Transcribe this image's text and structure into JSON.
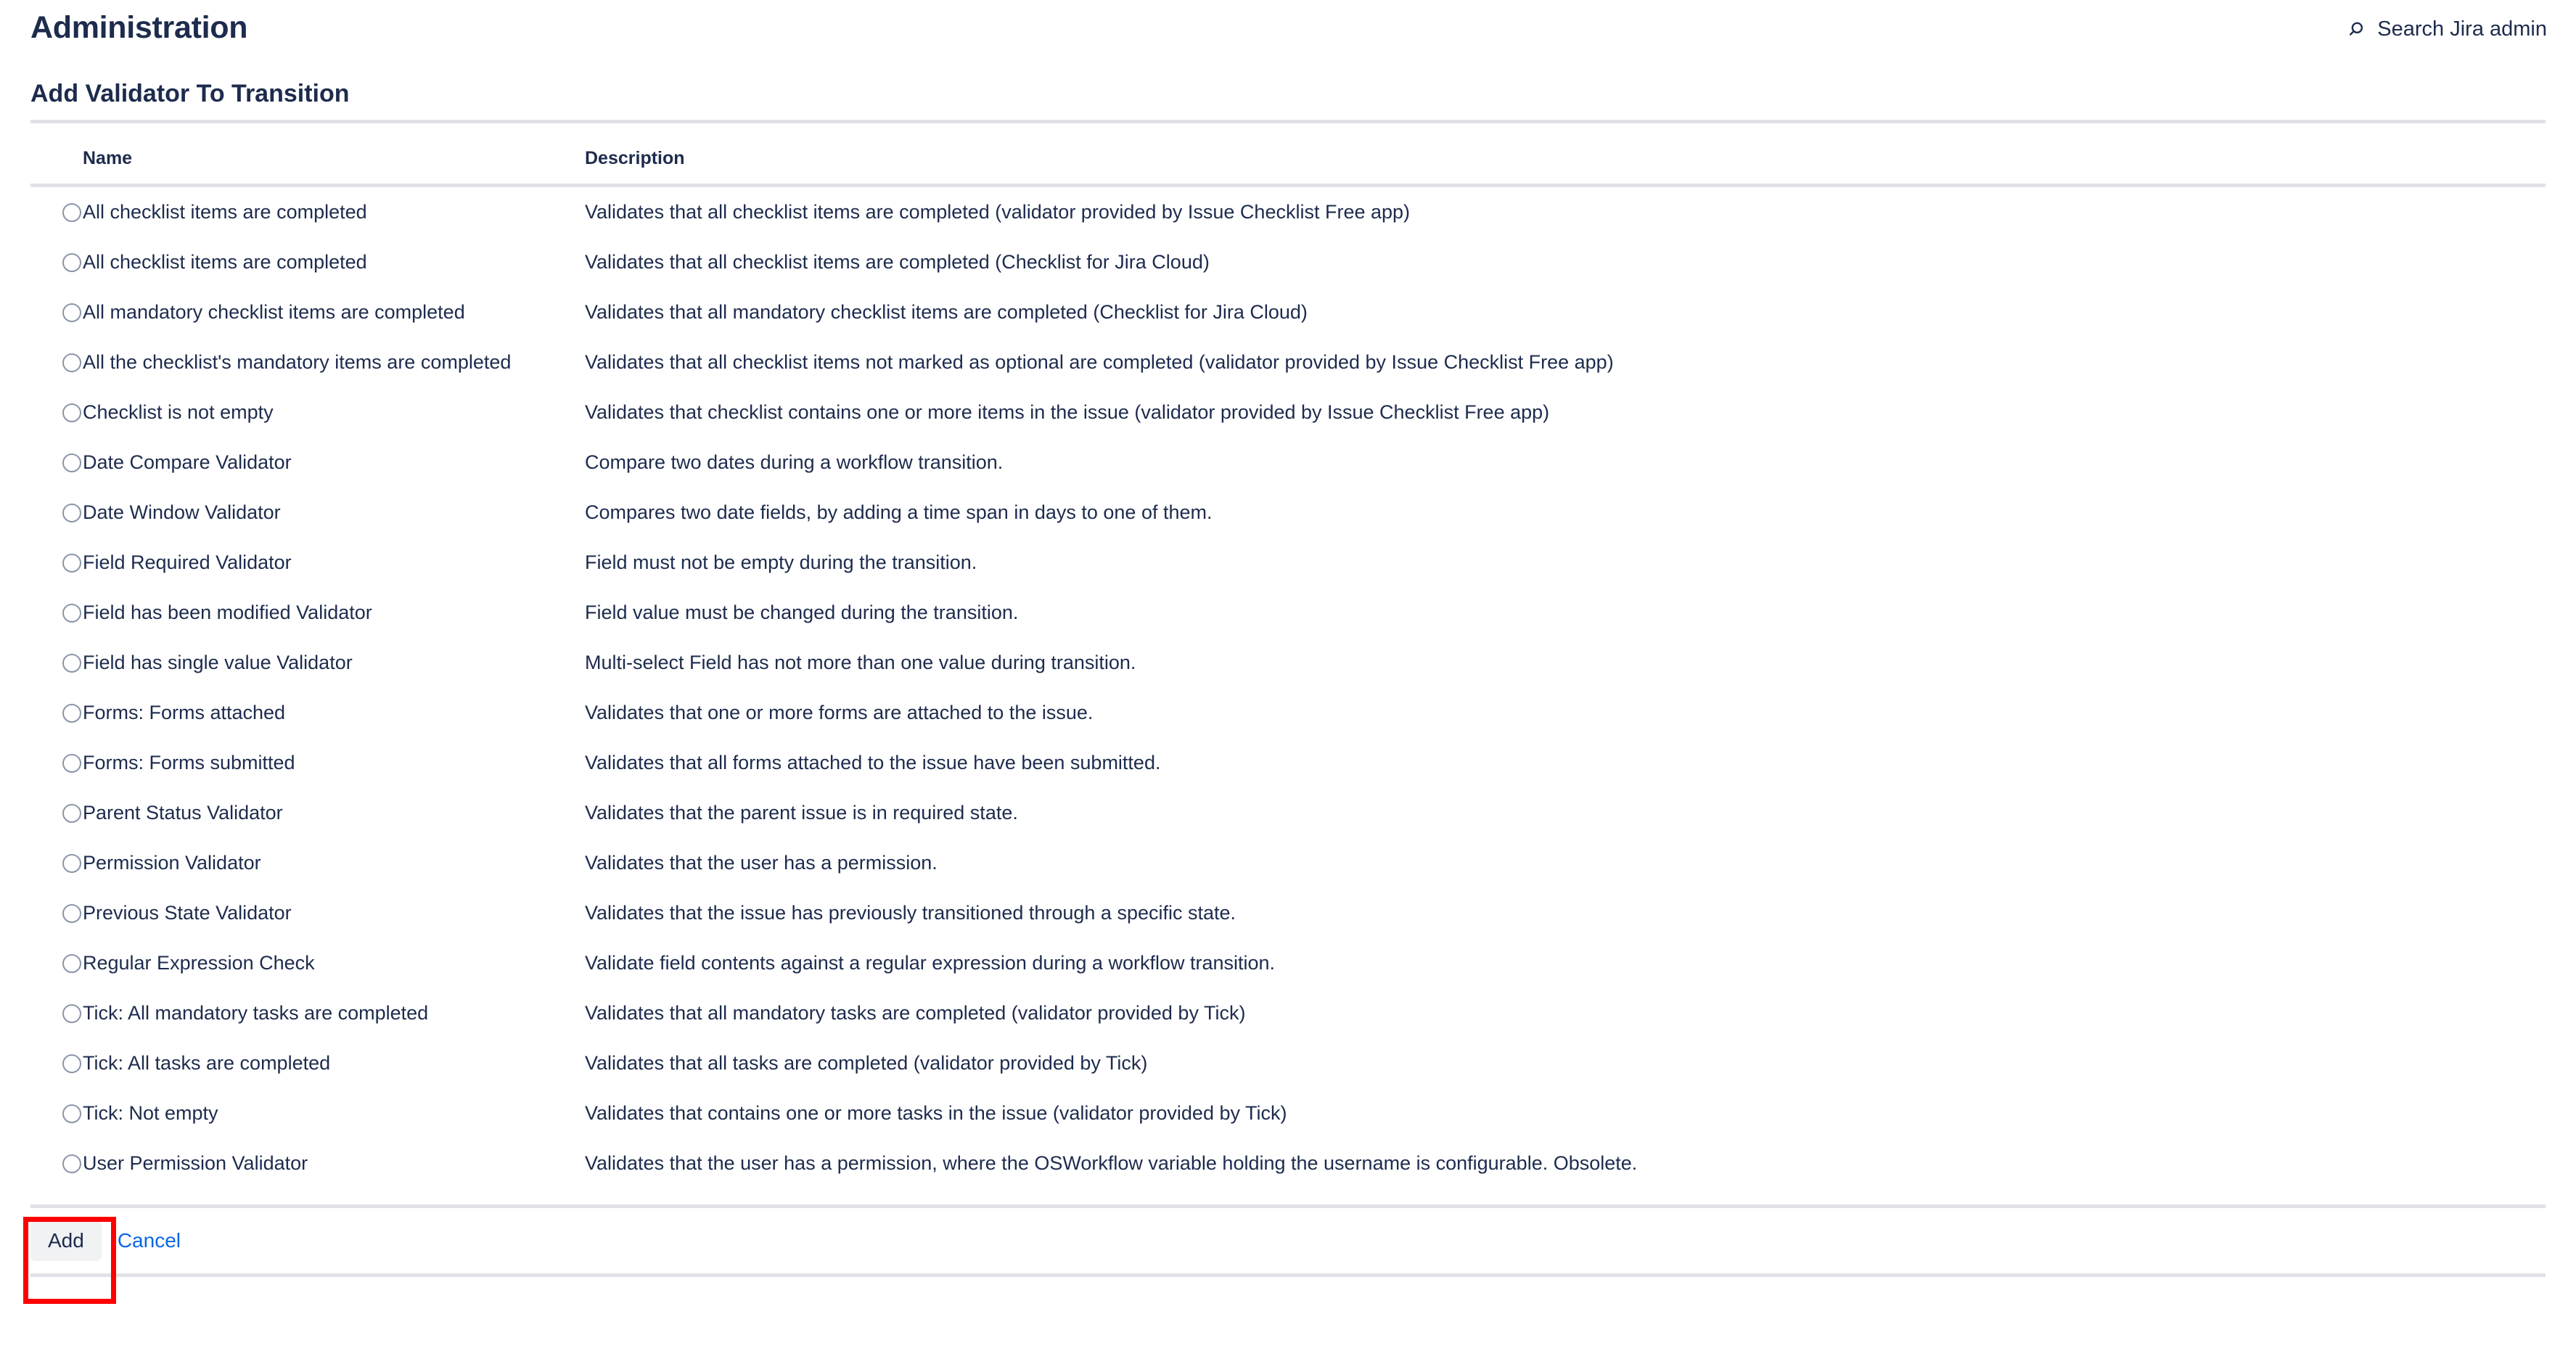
{
  "header": {
    "title": "Administration",
    "search_label": "Search Jira admin",
    "search_icon": "search-icon"
  },
  "page": {
    "heading": "Add Validator To Transition"
  },
  "table": {
    "columns": [
      "Name",
      "Description"
    ],
    "rows": [
      {
        "name": "All checklist items are completed",
        "description": "Validates that all checklist items are completed (validator provided by Issue Checklist Free app)",
        "selected": false
      },
      {
        "name": "All checklist items are completed",
        "description": "Validates that all checklist items are completed (Checklist for Jira Cloud)",
        "selected": false
      },
      {
        "name": "All mandatory checklist items are completed",
        "description": "Validates that all mandatory checklist items are completed (Checklist for Jira Cloud)",
        "selected": false
      },
      {
        "name": "All the checklist's mandatory items are completed",
        "description": "Validates that all checklist items not marked as optional are completed (validator provided by Issue Checklist Free app)",
        "selected": false
      },
      {
        "name": "Checklist is not empty",
        "description": "Validates that checklist contains one or more items in the issue (validator provided by Issue Checklist Free app)",
        "selected": false
      },
      {
        "name": "Date Compare Validator",
        "description": "Compare two dates during a workflow transition.",
        "selected": false
      },
      {
        "name": "Date Window Validator",
        "description": "Compares two date fields, by adding a time span in days to one of them.",
        "selected": false
      },
      {
        "name": "Field Required Validator",
        "description": "Field must not be empty during the transition.",
        "selected": false
      },
      {
        "name": "Field has been modified Validator",
        "description": "Field value must be changed during the transition.",
        "selected": false
      },
      {
        "name": "Field has single value Validator",
        "description": "Multi-select Field has not more than one value during transition.",
        "selected": false
      },
      {
        "name": "Forms: Forms attached",
        "description": "Validates that one or more forms are attached to the issue.",
        "selected": false
      },
      {
        "name": "Forms: Forms submitted",
        "description": "Validates that all forms attached to the issue have been submitted.",
        "selected": false
      },
      {
        "name": "Parent Status Validator",
        "description": "Validates that the parent issue is in required state.",
        "selected": false
      },
      {
        "name": "Permission Validator",
        "description": "Validates that the user has a permission.",
        "selected": false
      },
      {
        "name": "Previous State Validator",
        "description": "Validates that the issue has previously transitioned through a specific state.",
        "selected": false
      },
      {
        "name": "Regular Expression Check",
        "description": "Validate field contents against a regular expression during a workflow transition.",
        "selected": false
      },
      {
        "name": "Tick: All mandatory tasks are completed",
        "description": "Validates that all mandatory tasks are completed (validator provided by Tick)",
        "selected": false
      },
      {
        "name": "Tick: All tasks are completed",
        "description": "Validates that all tasks are completed (validator provided by Tick)",
        "selected": false
      },
      {
        "name": "Tick: Not empty",
        "description": "Validates that contains one or more tasks in the issue (validator provided by Tick)",
        "selected": false
      },
      {
        "name": "User Permission Validator",
        "description": "Validates that the user has a permission, where the OSWorkflow variable holding the username is configurable. Obsolete.",
        "selected": false
      }
    ]
  },
  "footer": {
    "add_label": "Add",
    "cancel_label": "Cancel"
  },
  "annotation": {
    "target": "Add",
    "color": "#ff0000"
  },
  "colors": {
    "text": "#172B4D",
    "link": "#0c66e4",
    "divider": "#dfe1e6",
    "button_bg": "#f1f2f4",
    "radio_border": "#8b95a8",
    "highlight": "#ff0000"
  }
}
